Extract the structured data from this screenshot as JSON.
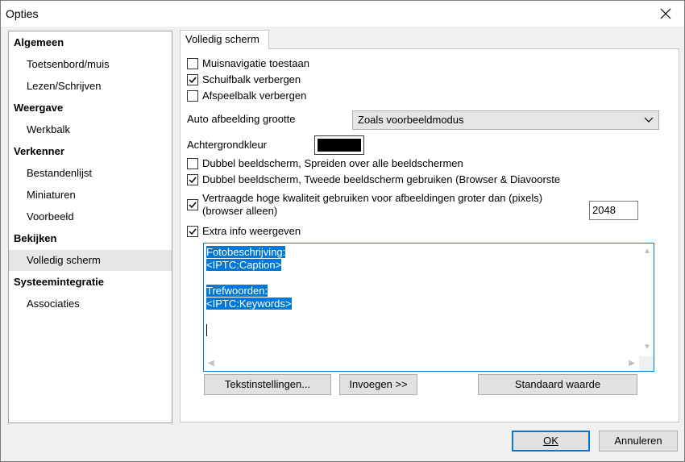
{
  "window": {
    "title": "Opties"
  },
  "sidebar": {
    "items": [
      {
        "label": "Algemeen",
        "kind": "group"
      },
      {
        "label": "Toetsenbord/muis",
        "kind": "sub"
      },
      {
        "label": "Lezen/Schrijven",
        "kind": "sub"
      },
      {
        "label": "Weergave",
        "kind": "group"
      },
      {
        "label": "Werkbalk",
        "kind": "sub"
      },
      {
        "label": "Verkenner",
        "kind": "group"
      },
      {
        "label": "Bestandenlijst",
        "kind": "sub"
      },
      {
        "label": "Miniaturen",
        "kind": "sub"
      },
      {
        "label": "Voorbeeld",
        "kind": "sub"
      },
      {
        "label": "Bekijken",
        "kind": "group"
      },
      {
        "label": "Volledig scherm",
        "kind": "sub",
        "selected": true
      },
      {
        "label": "Systeemintegratie",
        "kind": "group"
      },
      {
        "label": "Associaties",
        "kind": "sub"
      }
    ]
  },
  "tab": {
    "label": "Volledig scherm"
  },
  "options": {
    "mouse_nav": {
      "label": "Muisnavigatie toestaan",
      "checked": false
    },
    "hide_scrollbar": {
      "label": "Schuifbalk verbergen",
      "checked": true
    },
    "hide_playbar": {
      "label": "Afspeelbalk verbergen",
      "checked": false
    },
    "auto_size": {
      "label": "Auto afbeelding grootte",
      "value": "Zoals voorbeeldmodus"
    },
    "background": {
      "label": "Achtergrondkleur",
      "color": "#000000"
    },
    "dual_spread": {
      "label": "Dubbel beeldscherm, Spreiden over alle beeldschermen",
      "checked": false
    },
    "dual_second": {
      "label": "Dubbel beeldscherm, Tweede beeldscherm gebruiken (Browser & Diavoorste",
      "checked": true
    },
    "delayed_hq": {
      "label_line1": "Vertraagde hoge kwaliteit gebruiken voor afbeeldingen groter dan (pixels)",
      "label_line2": "(browser alleen)",
      "checked": true,
      "value": "2048"
    },
    "extra_info": {
      "label": "Extra info weergeven",
      "checked": true
    }
  },
  "info_text": {
    "lines": [
      "Fotobeschrijving:",
      "<IPTC:Caption>",
      "",
      "Trefwoorden:",
      "<IPTC:Keywords>"
    ]
  },
  "buttons": {
    "text_settings": "Tekstinstellingen...",
    "insert": "Invoegen >>",
    "default": "Standaard waarde",
    "ok": "OK",
    "cancel": "Annuleren"
  },
  "colors": {
    "accent": "#0078d7",
    "selection": "#0078d7"
  },
  "icons": {
    "close": "close-icon",
    "dropdown": "chevron-down-icon",
    "checkbox": "checkmark-icon"
  }
}
